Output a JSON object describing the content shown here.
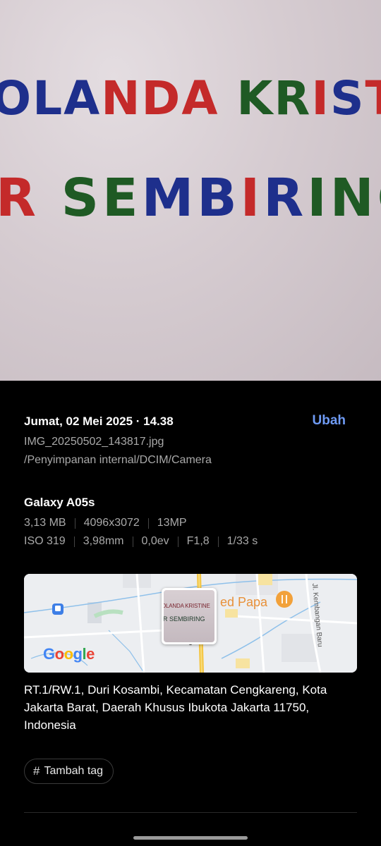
{
  "photo": {
    "line1": "OLANDA KRISTINE",
    "line2": "R SEMBIRING"
  },
  "details": {
    "datetime": "Jumat, 02 Mei 2025 · 14.38",
    "edit_label": "Ubah",
    "filename": "IMG_20250502_143817.jpg",
    "path": "/Penyimpanan internal/DCIM/Camera",
    "device": "Galaxy A05s",
    "file_size": "3,13 MB",
    "resolution": "4096x3072",
    "megapixels": "13MP",
    "iso": "ISO 319",
    "focal_length": "3,98mm",
    "exposure": "0,0ev",
    "aperture": "F1,8",
    "shutter": "1/33 s"
  },
  "map": {
    "poi": "ed Papa",
    "street": "Jl. Kembangan Baru",
    "logo": "Google",
    "thumb_line1": "OLANDA KRISTINE",
    "thumb_line2": "R SEMBIRING"
  },
  "address": "RT.1/RW.1, Duri Kosambi, Kecamatan Cengkareng, Kota Jakarta Barat, Daerah Khusus Ibukota Jakarta 11750, Indonesia",
  "tag_button": {
    "icon": "hash-icon",
    "label": "Tambah tag"
  },
  "colors": {
    "accent": "#6f9bf5",
    "ink_blue": "#1e2f8c",
    "ink_red": "#c42a2a",
    "ink_green": "#1f5a24"
  }
}
